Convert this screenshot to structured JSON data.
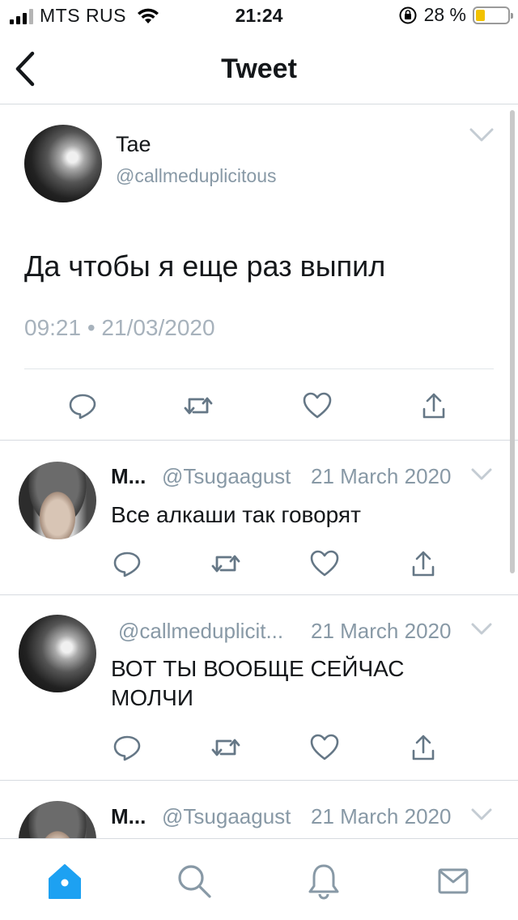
{
  "status_bar": {
    "carrier": "MTS RUS",
    "time": "21:24",
    "battery_percent": "28 %",
    "battery_level": 0.28,
    "colors": {
      "battery_fill": "#f2c200"
    }
  },
  "nav": {
    "title": "Tweet",
    "back_icon": "chevron-left-icon"
  },
  "main_tweet": {
    "name": "Tae",
    "handle": "@callmeduplicitous",
    "text": "Да чтобы я еще раз выпил",
    "timestamp": "09:21 • 21/03/2020",
    "actions": [
      "reply-icon",
      "retweet-icon",
      "like-icon",
      "share-icon"
    ]
  },
  "replies": [
    {
      "name": "M...",
      "handle": "@Tsugaagust",
      "date": "21 March 2020",
      "text": "Все алкаши так говорят"
    },
    {
      "name": "",
      "handle": "@callmeduplicit...",
      "date": "21 March 2020",
      "text": "ВОТ ТЫ ВООБЩЕ СЕЙЧАС МОЛЧИ"
    },
    {
      "name": "M...",
      "handle": "@Tsugaagust",
      "date": "21 March 2020",
      "text": ""
    }
  ],
  "tab_bar": {
    "items": [
      "home-icon",
      "search-icon",
      "notifications-icon",
      "messages-icon"
    ],
    "active": "home-icon",
    "colors": {
      "active": "#1da1f2",
      "inactive": "#8899a6"
    }
  }
}
